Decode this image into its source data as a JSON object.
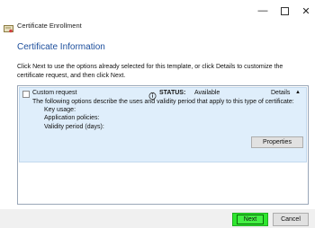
{
  "window": {
    "app_title": "Certificate Enrollment",
    "icons": {
      "minimize": "minimize-icon",
      "maximize": "maximize-icon",
      "close": "close-icon",
      "app": "certificate-icon"
    }
  },
  "page": {
    "title": "Certificate Information",
    "instructions": "Click Next to use the options already selected for this template, or click Details to customize the certificate request, and then click Next."
  },
  "template": {
    "name": "Custom request",
    "status_label": "STATUS:",
    "status_value": "Available",
    "details_label": "Details",
    "description": "The following options describe the uses and validity period that apply to this type of certificate:",
    "fields": [
      "Key usage:",
      "Application policies:",
      "Validity period (days):"
    ],
    "properties_button": "Properties",
    "selected": false
  },
  "footer": {
    "next_label": "Next",
    "cancel_label": "Cancel"
  },
  "colors": {
    "heading": "#1c4e9c",
    "item_background": "#dfeefb",
    "next_highlight": "#2ee62e"
  }
}
